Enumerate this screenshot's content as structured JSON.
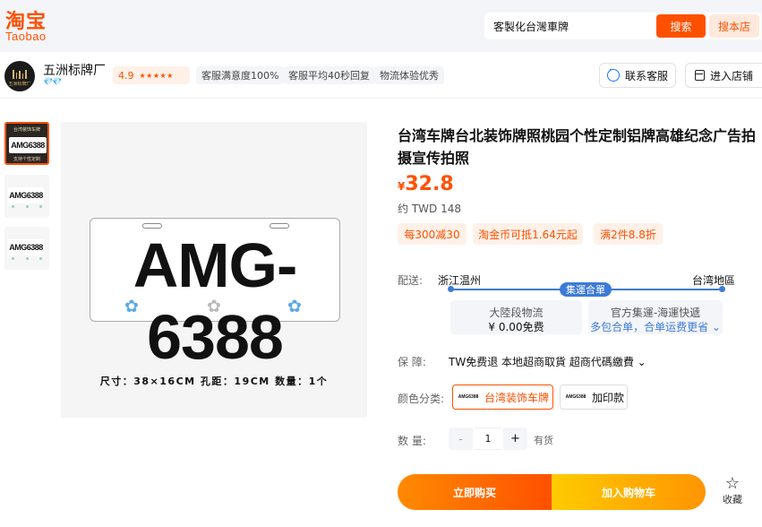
{
  "header": {
    "logo_cn": "淘宝",
    "logo_en": "Taobao",
    "search_value": "客製化台灣車牌",
    "search_button": "搜索",
    "store_search_button": "搜本店"
  },
  "shop": {
    "avatar_caption": "五洲标牌厂",
    "name": "五洲标牌厂",
    "diamonds": "💎💎",
    "rating": "4.9",
    "stars": "★★★★★",
    "badges": [
      "客服满意度100%",
      "客服平均40秒回复",
      "物流体验优秀"
    ],
    "customer_service": "联系客服",
    "enter_store": "进入店铺"
  },
  "gallery": {
    "thumb_plate": "AMG6388",
    "thumb1_top": "台湾装饰车牌",
    "thumb1_bottom": "支持个性定制",
    "plate_text": "AMG-6388",
    "spec": "尺寸：38×16CM  孔距：19CM  数量：1个"
  },
  "product": {
    "title": "台湾车牌台北装饰牌照桃园个性定制铝牌高雄纪念广告拍摄宣传拍照",
    "currency": "¥",
    "price": "32.8",
    "approx": "约 TWD 148",
    "promos": [
      "每300减30",
      "淘金币可抵1.64元起",
      "满2件8.8折"
    ],
    "delivery_label": "配送:",
    "origin": "浙江温州",
    "destination": "台湾地區",
    "route_tag": "集運合單",
    "leg1_title": "大陸段物流",
    "leg1_price": "¥ 0.00免费",
    "leg2_title": "官方集運-海運快遞",
    "leg2_note": "多包合单，合单运费更省 ⌄",
    "guarantee_label": "保    障:",
    "guarantee_text": "TW免费退 本地超商取貨 超商代碼繳費 ⌄",
    "color_label": "颜色分类:",
    "variants": [
      "台湾装饰车牌",
      "加印款"
    ],
    "variant_thumb": "AMG6388",
    "qty_label": "数    量:",
    "qty_minus": "-",
    "qty_value": "1",
    "qty_plus": "+",
    "stock": "有货",
    "buy_now": "立即购买",
    "add_to_cart": "加入购物车",
    "favorite": "收藏"
  },
  "colors": {
    "brand_orange": "#ff5000",
    "route_blue": "#3d7bd6",
    "star_blue": "#5aa9e6"
  }
}
